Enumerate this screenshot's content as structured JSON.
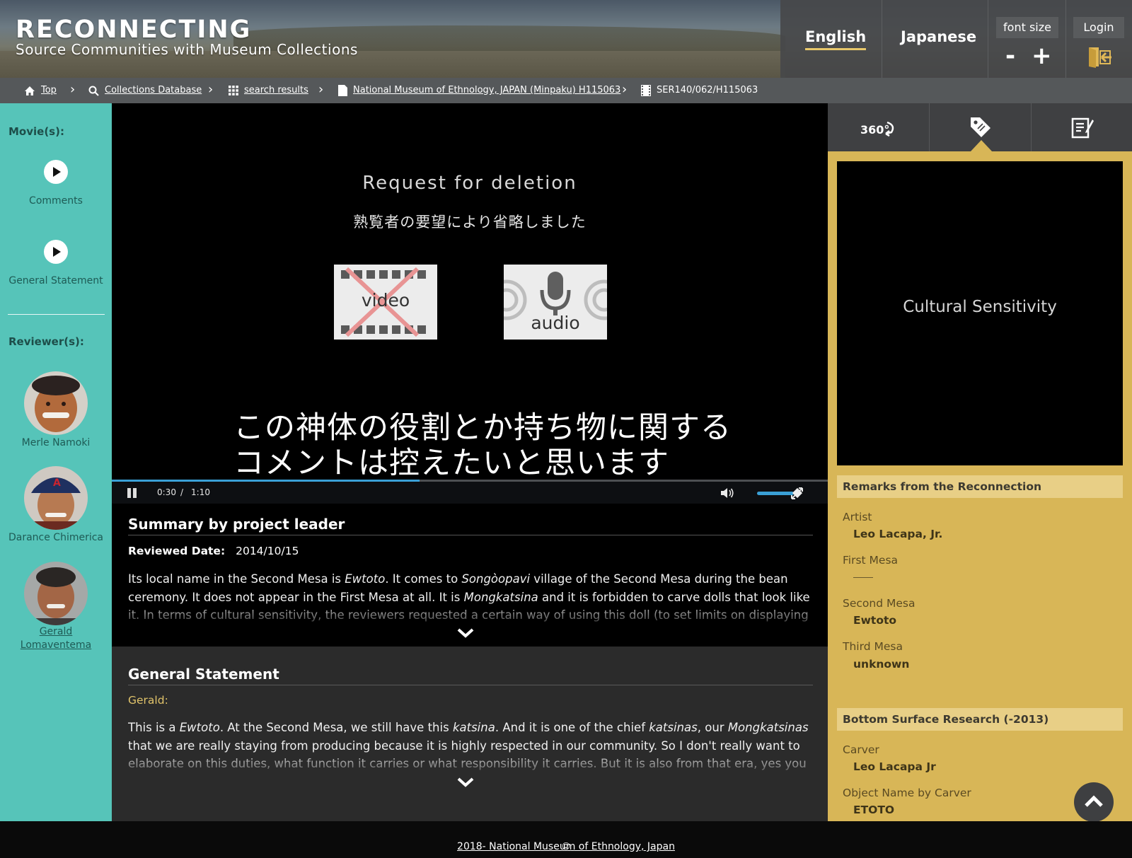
{
  "header": {
    "title": "RECONNECTING",
    "subtitle": "Source Communities with Museum Collections",
    "languages": [
      "English",
      "Japanese"
    ],
    "active_language": "English",
    "font_size_label": "font size",
    "font_decrease": "-",
    "font_increase": "+",
    "login_label": "Login",
    "accent_color": "#e8c86a"
  },
  "breadcrumb": [
    {
      "icon": "home-icon",
      "label": "Top"
    },
    {
      "icon": "search-icon",
      "label": "Collections Database"
    },
    {
      "icon": "grid-icon",
      "label": "search results"
    },
    {
      "icon": "document-icon",
      "label": "National Museum of Ethnology, JAPAN (Minpaku) H115063"
    },
    {
      "icon": "film-icon",
      "label": "SER140/062/H115063"
    }
  ],
  "sidebar": {
    "movies_heading": "Movie(s):",
    "movies": [
      "Comments",
      "General Statement"
    ],
    "reviewers_heading": "Reviewer(s):",
    "reviewers": [
      "Merle Namoki",
      "Darance Chimerica",
      "Gerald Lomaventema"
    ],
    "background_color": "#56c4b9"
  },
  "video": {
    "notice_title": "Request for deletion",
    "notice_subtitle_jp": "熟覧者の要望により省略しました",
    "video_label": "video",
    "audio_label": "audio",
    "caption_line1": "この神体の役割とか持ち物に関する",
    "caption_line2": "コメントは控えたいと思います",
    "current_time": "0:30",
    "time_separator": "/",
    "duration": "1:10",
    "progress_fraction": 0.43,
    "volume_fraction": 0.9
  },
  "summary": {
    "heading": "Summary by project leader",
    "reviewed_label": "Reviewed Date:",
    "reviewed_date": "2014/10/15",
    "text_1": "Its local name in the Second Mesa is ",
    "text_1_em": "Ewtoto",
    "text_2": ". It comes to ",
    "text_2_em": "Songòopavi",
    "text_3": " village of the Second Mesa during the bean ceremony. It does not appear in the First Mesa at all. It is ",
    "text_3_em": "Mongkatsina",
    "text_4": " and it is forbidden to carve dolls that look like it. In terms of cultural sensitivity, the reviewers requested a certain way of using this doll (to set limits on displaying it in"
  },
  "general_statement": {
    "heading": "General Statement",
    "speaker": "Gerald:",
    "text_1": "This is a ",
    "text_1_em": "Ewtoto",
    "text_2": ". At the Second Mesa, we still have this ",
    "text_2_em": "katsina",
    "text_3": ". And it is one of the chief ",
    "text_3_em": "katsinas",
    "text_4": ", our ",
    "text_4_em": "Mongkatsinas",
    "text_5": " that we are really staying from producing because it is highly respected in our community. So I don't really want to elaborate on this duties, what function it carries or what responsibility it carries. But it is also from that era, yes you can see where"
  },
  "right_panel": {
    "tabs": [
      "360-view-icon",
      "tag-icon",
      "notes-icon"
    ],
    "tab_360_label": "360°",
    "active_tab": "tag-icon",
    "image_placeholder": "Cultural Sensitivity",
    "remarks_heading": "Remarks from the Reconnection",
    "remarks": [
      {
        "label": "Artist",
        "value": "Leo Lacapa, Jr."
      },
      {
        "label": "First Mesa",
        "value": ""
      },
      {
        "label": "Second Mesa",
        "value": "Ewtoto"
      },
      {
        "label": "Third Mesa",
        "value": "unknown"
      }
    ],
    "bottom_heading": "Bottom Surface Research (-2013)",
    "bottom": [
      {
        "label": "Carver",
        "value": "Leo Lacapa Jr"
      },
      {
        "label": "Object Name by Carver",
        "value": "ETOTO"
      }
    ],
    "background_color": "#d8b657"
  },
  "footer": {
    "copyright_symbol": "©",
    "copyright_text": "2018- National Museum of Ethnology, Japan"
  }
}
